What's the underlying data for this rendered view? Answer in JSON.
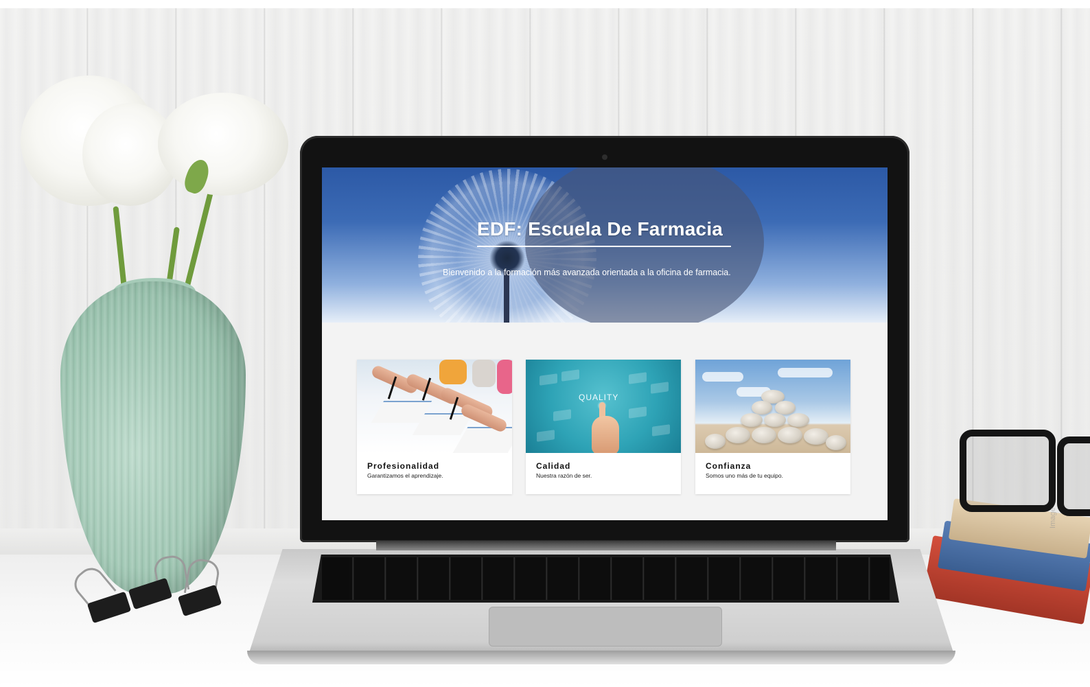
{
  "hero": {
    "title": "EDF: Escuela De Farmacia",
    "subtitle": "Bienvenido a la formación más avanzada orientada a la oficina de farmacia."
  },
  "cards": [
    {
      "title": "Profesionalidad",
      "text": "Garantizamos el aprendizaje.",
      "image": "students-writing-photo"
    },
    {
      "title": "Calidad",
      "text": "Nuestra razón de ser.",
      "image": "quality-touchscreen-photo",
      "image_text": "QUALITY"
    },
    {
      "title": "Confianza",
      "text": "Somos uno más de tu equipo.",
      "image": "stacked-stones-photo"
    }
  ],
  "colors": {
    "hero_blue": "#2c59a6",
    "overlay": "#485676",
    "content_bg": "#f3f3f3"
  },
  "watermark": "Image"
}
